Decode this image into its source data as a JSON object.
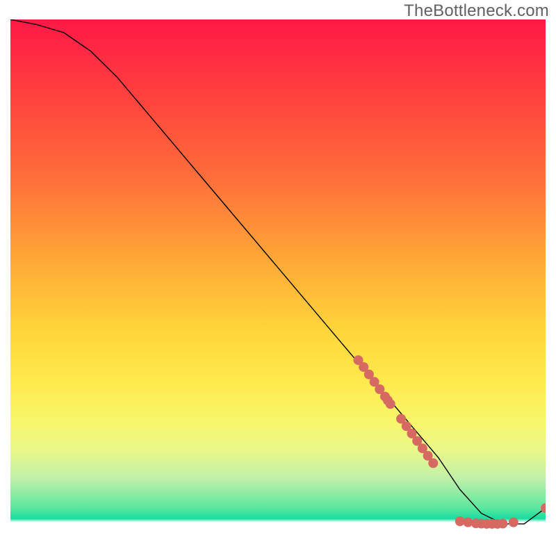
{
  "watermark": "TheBottleneck.com",
  "chart_data": {
    "type": "line",
    "title": "",
    "xlabel": "",
    "ylabel": "",
    "xlim": [
      0,
      100
    ],
    "ylim": [
      0,
      100
    ],
    "grid": false,
    "legend": false,
    "series": [
      {
        "name": "bottleneck-curve",
        "x": [
          0,
          5,
          10,
          15,
          20,
          25,
          30,
          35,
          40,
          45,
          50,
          55,
          60,
          65,
          70,
          75,
          80,
          84,
          88,
          92,
          96,
          100
        ],
        "y": [
          100,
          99,
          97.5,
          94,
          89,
          83,
          77,
          71,
          65,
          59,
          53,
          47,
          41,
          35,
          29,
          23,
          17,
          11,
          6.5,
          4.5,
          4.5,
          7.5
        ],
        "stroke": "#000000",
        "stroke_width": 1.4
      }
    ],
    "markers": [
      {
        "name": "highlight-dots",
        "symbol": "filled-circle",
        "color": "#d66a62",
        "radius": 7,
        "points": [
          [
            65,
            35.5
          ],
          [
            66,
            34.2
          ],
          [
            67,
            32.8
          ],
          [
            68,
            31.4
          ],
          [
            69,
            30.0
          ],
          [
            70,
            28.6
          ],
          [
            70.5,
            27.9
          ],
          [
            71,
            27.2
          ],
          [
            73,
            24.4
          ],
          [
            74,
            23.0
          ],
          [
            75,
            21.6
          ],
          [
            76,
            20.2
          ],
          [
            77,
            18.8
          ],
          [
            78,
            17.4
          ],
          [
            79,
            16.0
          ],
          [
            84,
            5.0
          ],
          [
            85.5,
            4.8
          ],
          [
            87,
            4.6
          ],
          [
            88,
            4.55
          ],
          [
            89,
            4.5
          ],
          [
            90,
            4.5
          ],
          [
            91,
            4.5
          ],
          [
            92,
            4.55
          ],
          [
            94,
            4.8
          ],
          [
            100,
            7.5
          ]
        ]
      }
    ]
  }
}
